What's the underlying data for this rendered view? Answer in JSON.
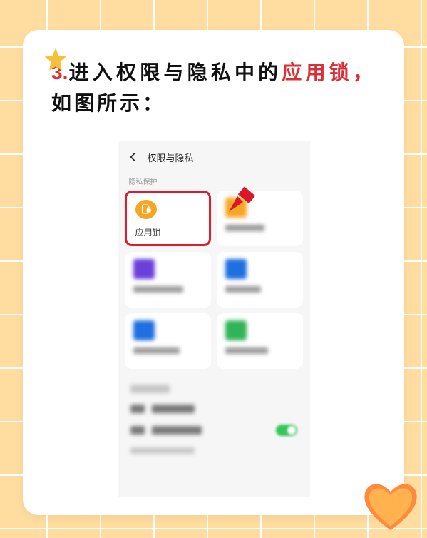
{
  "instruction": {
    "step_no": "3.",
    "part1": "进入权限与隐私中的",
    "highlight": "应用锁，",
    "part2": "如图所示："
  },
  "phone": {
    "screen_title": "权限与隐私",
    "section_label": "隐私保护",
    "app_lock_label": "应用锁"
  },
  "icons": {
    "star": "star-icon",
    "heart": "heart-icon",
    "back": "back-arrow-icon",
    "pointer": "red-arrow-icon",
    "lock": "app-lock-icon"
  }
}
